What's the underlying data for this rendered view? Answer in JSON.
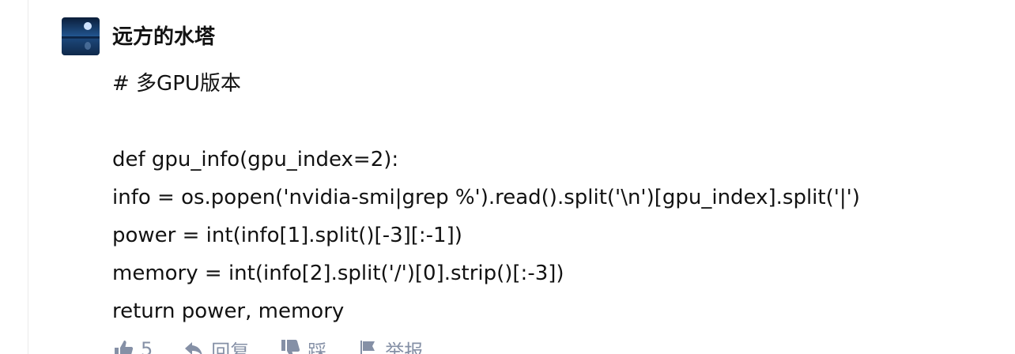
{
  "comment": {
    "author": "远方的水塔",
    "lines": [
      "# 多GPU版本",
      "",
      "def gpu_info(gpu_index=2):",
      "info = os.popen('nvidia-smi|grep %').read().split('\\n')[gpu_index].split('|')",
      "power = int(info[1].split()[-3][:-1])",
      "memory = int(info[2].split('/')[0].strip()[:-3])",
      "return power, memory"
    ]
  },
  "actions": {
    "like_count": "5",
    "reply_label": "回复",
    "dislike_label": "踩",
    "report_label": "举报"
  },
  "colors": {
    "text": "#121212",
    "muted": "#8590a6",
    "border": "#ebebeb"
  }
}
